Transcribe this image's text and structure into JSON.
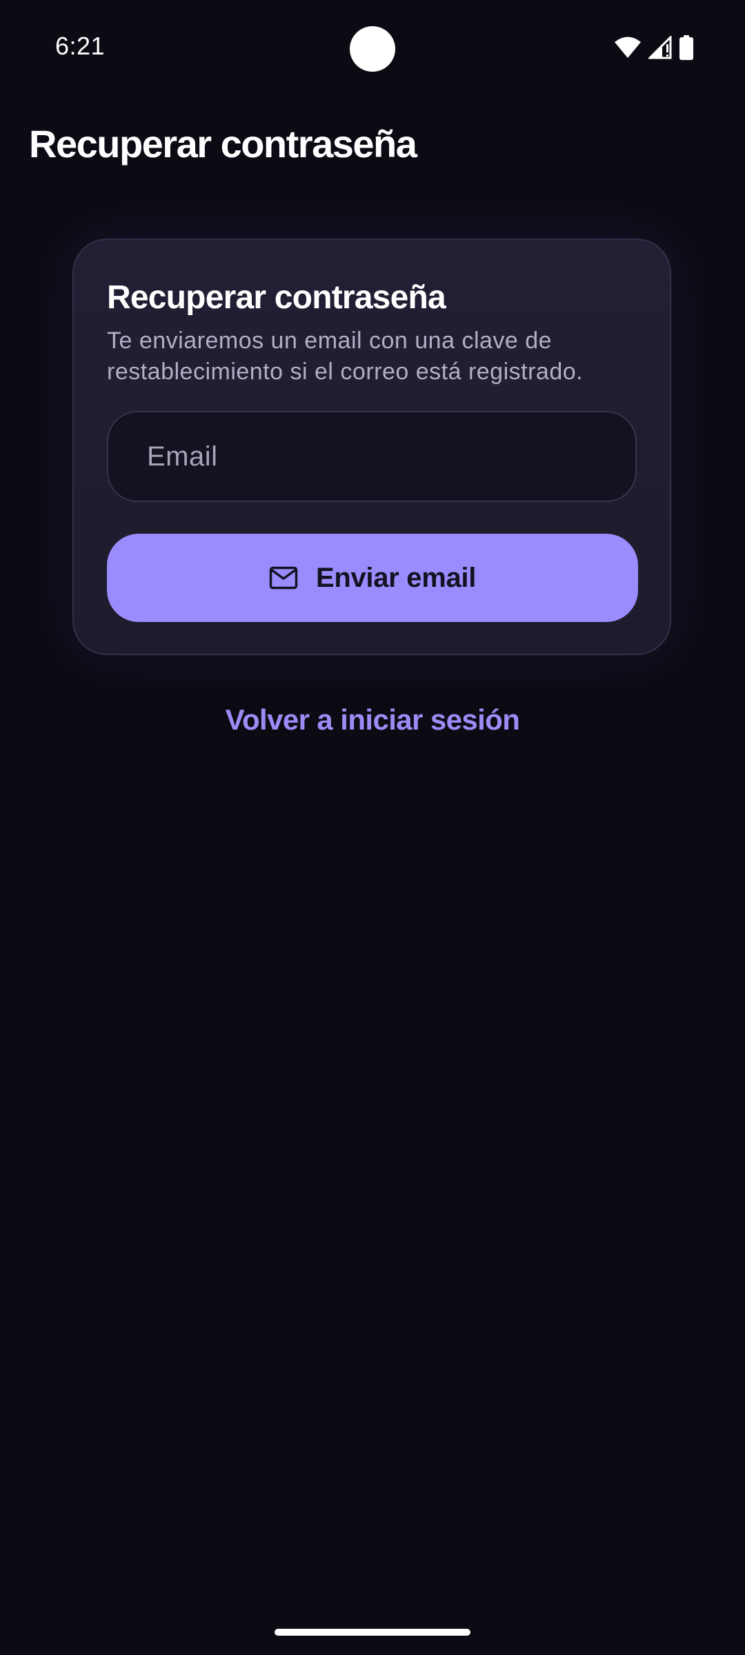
{
  "status_bar": {
    "time": "6:21",
    "icons": [
      "wifi-icon",
      "cell-signal-icon",
      "battery-icon"
    ]
  },
  "app_bar": {
    "title": "Recuperar contraseña"
  },
  "card": {
    "title": "Recuperar contraseña",
    "subtitle": "Te enviaremos un email con una clave de restablecimiento si el correo está registrado.",
    "email_field": {
      "placeholder": "Email",
      "value": ""
    },
    "send_button": {
      "label": "Enviar email",
      "icon": "mail-icon"
    }
  },
  "back_link": {
    "label": "Volver a iniciar sesión"
  },
  "colors": {
    "background": "#0c0b14",
    "card": "#211d30",
    "accent": "#9a8cfc",
    "link": "#9b8cf6",
    "muted_text": "#b3aec6"
  }
}
